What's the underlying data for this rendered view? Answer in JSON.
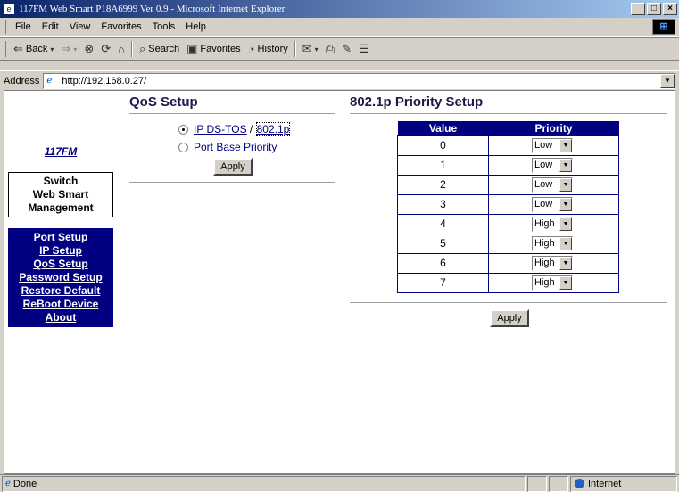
{
  "window": {
    "title": "117FM Web Smart P18A6999 Ver 0.9 - Microsoft Internet Explorer",
    "app_icon": "ie-page-icon",
    "minimize": "_",
    "maximize": "□",
    "close": "×"
  },
  "menu": {
    "items": [
      "File",
      "Edit",
      "View",
      "Favorites",
      "Tools",
      "Help"
    ]
  },
  "toolbar": {
    "back": "Back",
    "search": "Search",
    "favorites": "Favorites",
    "history": "History"
  },
  "address": {
    "label": "Address",
    "url": "http://192.168.0.27/"
  },
  "nav": {
    "brand": "117FM",
    "switch_lines": [
      "Switch",
      "Web Smart",
      "Management"
    ],
    "links": [
      "Port Setup",
      "IP Setup",
      "QoS Setup",
      "Password Setup",
      "Restore Default",
      "ReBoot Device",
      "About"
    ]
  },
  "qos": {
    "title": "QoS Setup",
    "option1_a": "IP DS-TOS",
    "option1_sep": " / ",
    "option1_b": "802.1p",
    "option2": "Port Base Priority",
    "apply": "Apply"
  },
  "priority": {
    "title": "802.1p Priority Setup",
    "col_value": "Value",
    "col_priority": "Priority",
    "rows": [
      {
        "value": "0",
        "priority": "Low"
      },
      {
        "value": "1",
        "priority": "Low"
      },
      {
        "value": "2",
        "priority": "Low"
      },
      {
        "value": "3",
        "priority": "Low"
      },
      {
        "value": "4",
        "priority": "High"
      },
      {
        "value": "5",
        "priority": "High"
      },
      {
        "value": "6",
        "priority": "High"
      },
      {
        "value": "7",
        "priority": "High"
      }
    ],
    "apply": "Apply"
  },
  "status": {
    "text": "Done",
    "zone": "Internet"
  }
}
